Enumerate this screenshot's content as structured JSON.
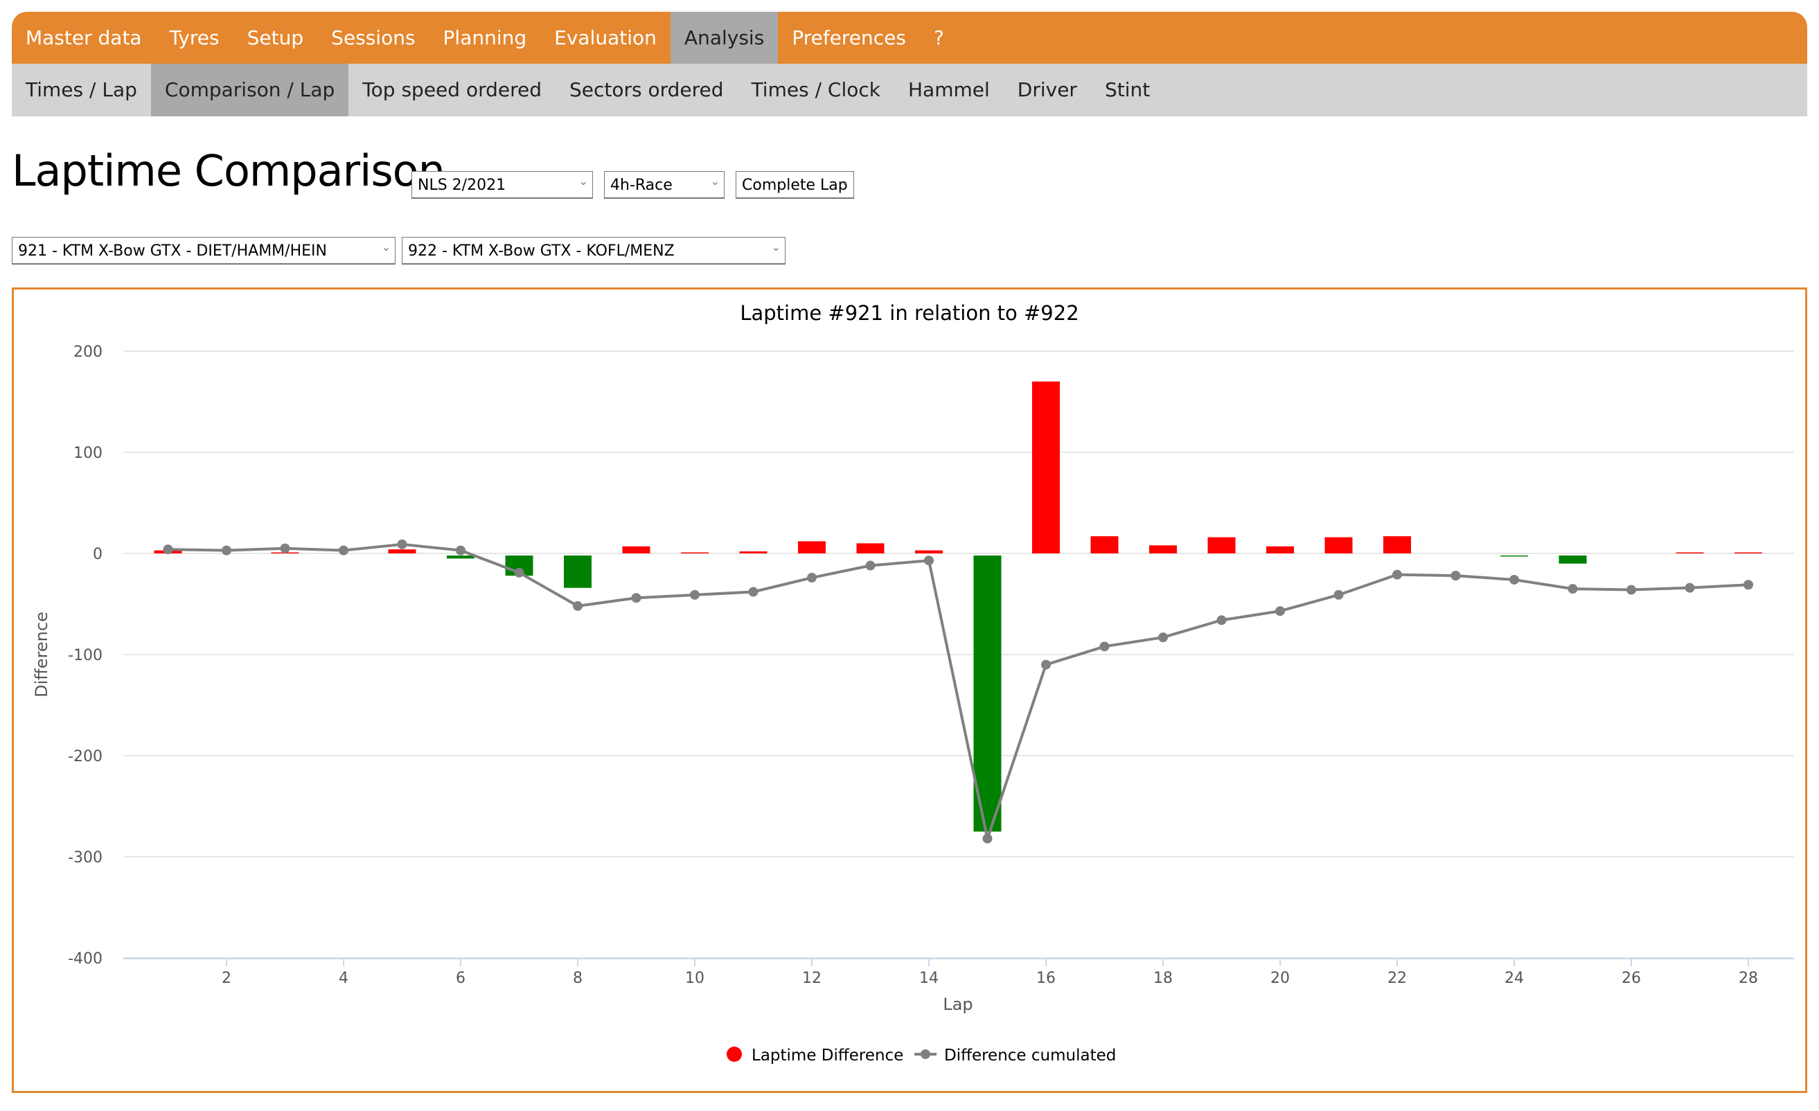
{
  "nav": {
    "items": [
      "Master data",
      "Tyres",
      "Setup",
      "Sessions",
      "Planning",
      "Evaluation",
      "Analysis",
      "Preferences",
      "?"
    ],
    "active": 6
  },
  "subnav": {
    "items": [
      "Times / Lap",
      "Comparison / Lap",
      "Top speed ordered",
      "Sectors ordered",
      "Times / Clock",
      "Hammel",
      "Driver",
      "Stint"
    ],
    "active": 1
  },
  "page_title": "Laptime Comparison",
  "filters": {
    "event": "NLS 2/2021",
    "session": "4h-Race",
    "sector": "Complete Lap",
    "car1": "921 - KTM X-Bow GTX - DIET/HAMM/HEIN",
    "car2": "922 - KTM X-Bow GTX - KOFL/MENZ"
  },
  "colors": {
    "accent": "#e4872f",
    "positive": "#ff0000",
    "negative": "#008000",
    "line": "#808080"
  },
  "chart_data": {
    "type": "bar",
    "title": "Laptime #921 in relation to #922",
    "xlabel": "Lap",
    "ylabel": "Difference",
    "ylim": [
      -400,
      200
    ],
    "yticks": [
      200,
      100,
      0,
      -100,
      -200,
      -300,
      -400
    ],
    "xticks": [
      2,
      4,
      6,
      8,
      10,
      12,
      14,
      16,
      18,
      20,
      22,
      24,
      26,
      28
    ],
    "grid": true,
    "legend": "bottom",
    "x": [
      1,
      2,
      3,
      4,
      5,
      6,
      7,
      8,
      9,
      10,
      11,
      12,
      13,
      14,
      15,
      16,
      17,
      18,
      19,
      20,
      21,
      22,
      23,
      24,
      25,
      26,
      27,
      28
    ],
    "series": [
      {
        "name": "Laptime Difference",
        "type": "bar",
        "values": [
          3,
          0,
          1,
          0,
          4,
          -3,
          -20,
          -32,
          7,
          1,
          2,
          12,
          10,
          3,
          -273,
          170,
          17,
          8,
          16,
          7,
          16,
          17,
          0,
          -1,
          -8,
          0,
          1,
          1
        ]
      },
      {
        "name": "Difference cumulated",
        "type": "line",
        "values": [
          4,
          3,
          5,
          3,
          9,
          3,
          -19,
          -52,
          -44,
          -41,
          -38,
          -24,
          -12,
          -7,
          -282,
          -110,
          -92,
          -83,
          -66,
          -57,
          -41,
          -21,
          -22,
          -26,
          -35,
          -36,
          -34,
          -31
        ]
      }
    ]
  }
}
